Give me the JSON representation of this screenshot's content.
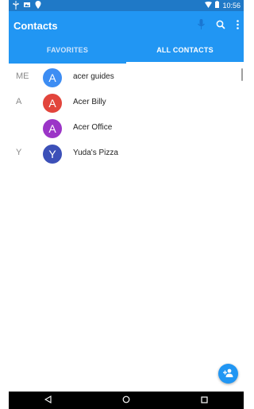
{
  "status_bar": {
    "time": "10:56",
    "icons_left": [
      "usb-icon",
      "image-icon",
      "location-icon"
    ],
    "icons_right": [
      "wifi-icon",
      "battery-icon"
    ]
  },
  "app_bar": {
    "title": "Contacts",
    "actions": [
      "mic-icon",
      "search-icon",
      "more-vert-icon"
    ]
  },
  "tabs": [
    {
      "label": "FAVORITES",
      "selected": false
    },
    {
      "label": "ALL CONTACTS",
      "selected": true
    }
  ],
  "contacts": [
    {
      "section": "ME",
      "initial": "A",
      "name": "acer guides",
      "color": "#3d8df3"
    },
    {
      "section": "A",
      "initial": "A",
      "name": "Acer Billy",
      "color": "#e2453c"
    },
    {
      "section": "",
      "initial": "A",
      "name": "Acer Office",
      "color": "#9b35c7"
    },
    {
      "section": "Y",
      "initial": "Y",
      "name": "Yuda's Pizza",
      "color": "#3c50b8"
    }
  ],
  "fab": {
    "icon": "add-contact-icon"
  },
  "nav_bar": {
    "buttons": [
      "back-icon",
      "home-icon",
      "recents-icon"
    ]
  },
  "colors": {
    "primary": "#2196f3",
    "primary_dark": "#1f79c7"
  }
}
